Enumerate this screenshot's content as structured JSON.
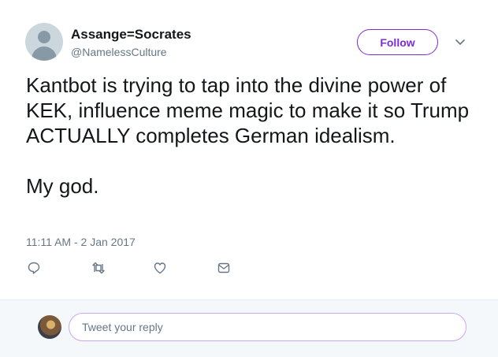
{
  "user": {
    "display_name": "Assange=Socrates",
    "handle": "@NamelessCulture"
  },
  "follow_label": "Follow",
  "tweet": {
    "paragraphs": [
      "Kantbot is trying to tap into the divine power of KEK, influence meme magic to make it so Trump ACTUALLY completes German idealism.",
      "My god."
    ],
    "timestamp": "11:11 AM - 2 Jan 2017"
  },
  "actions": [
    "reply-icon",
    "retweet-icon",
    "heart-icon",
    "direct-message-icon"
  ],
  "reply_box": {
    "placeholder": "Tweet your reply"
  },
  "colors": {
    "accent": "#7b2cd8",
    "text": "#14171a",
    "secondary": "#657786",
    "reply_bg": "#f5f8fa"
  }
}
